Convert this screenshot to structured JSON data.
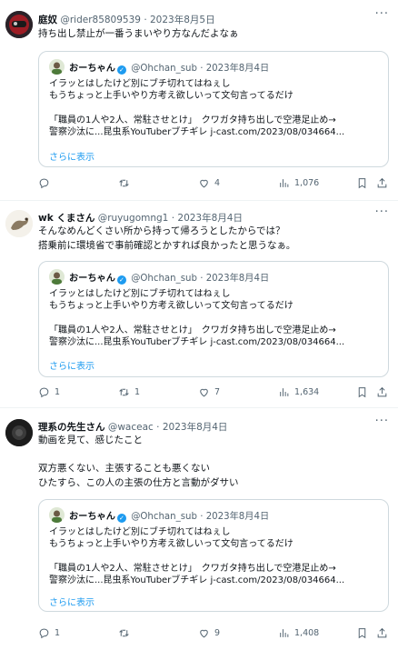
{
  "tweets": [
    {
      "name": "庭奴",
      "handle": "@rider85809539",
      "date": "2023年8月5日",
      "text": "持ち出し禁止が一番うまいやり方なんだよなぁ",
      "reply_count": "",
      "retweet_count": "",
      "like_count": "4",
      "views": "1,076"
    },
    {
      "name": "wk くまさん",
      "handle": "@ruyugomng1",
      "date": "2023年8月4日",
      "text": "そんなめんどくさい所から持って帰ろうとしたからでは？\n搭乗前に環境省で事前確認とかすれば良かったと思うなぁ。",
      "reply_count": "1",
      "retweet_count": "1",
      "like_count": "7",
      "views": "1,634"
    },
    {
      "name": "理系の先生さん",
      "handle": "@waceac",
      "date": "2023年8月4日",
      "text": "動画を見て、感じたこと\n\n双方悪くない、主張することも悪くない\nひたすら、この人の主張の仕方と言動がダサい",
      "reply_count": "1",
      "retweet_count": "",
      "like_count": "9",
      "views": "1,408"
    }
  ],
  "quote": {
    "name": "おーちゃん",
    "handle": "@Ohchan_sub",
    "date": "2023年8月4日",
    "text": "イラッとはしたけど別にブチ切れてはねぇし\nもうちょっと上手いやり方考え欲しいって文句言ってるだけ\n\n「職員の1人や2人、常駐させとけ」　クワガタ持ち出しで空港足止め→\n警察沙汰に...昆虫系YouTuberブチギレ j-cast.com/2023/08/034664...",
    "show_more": "さらに表示"
  },
  "separator": "·",
  "more_icon": "···",
  "colors": {
    "link": "#1d9bf0",
    "muted": "#536471",
    "border": "#cfd9de"
  }
}
